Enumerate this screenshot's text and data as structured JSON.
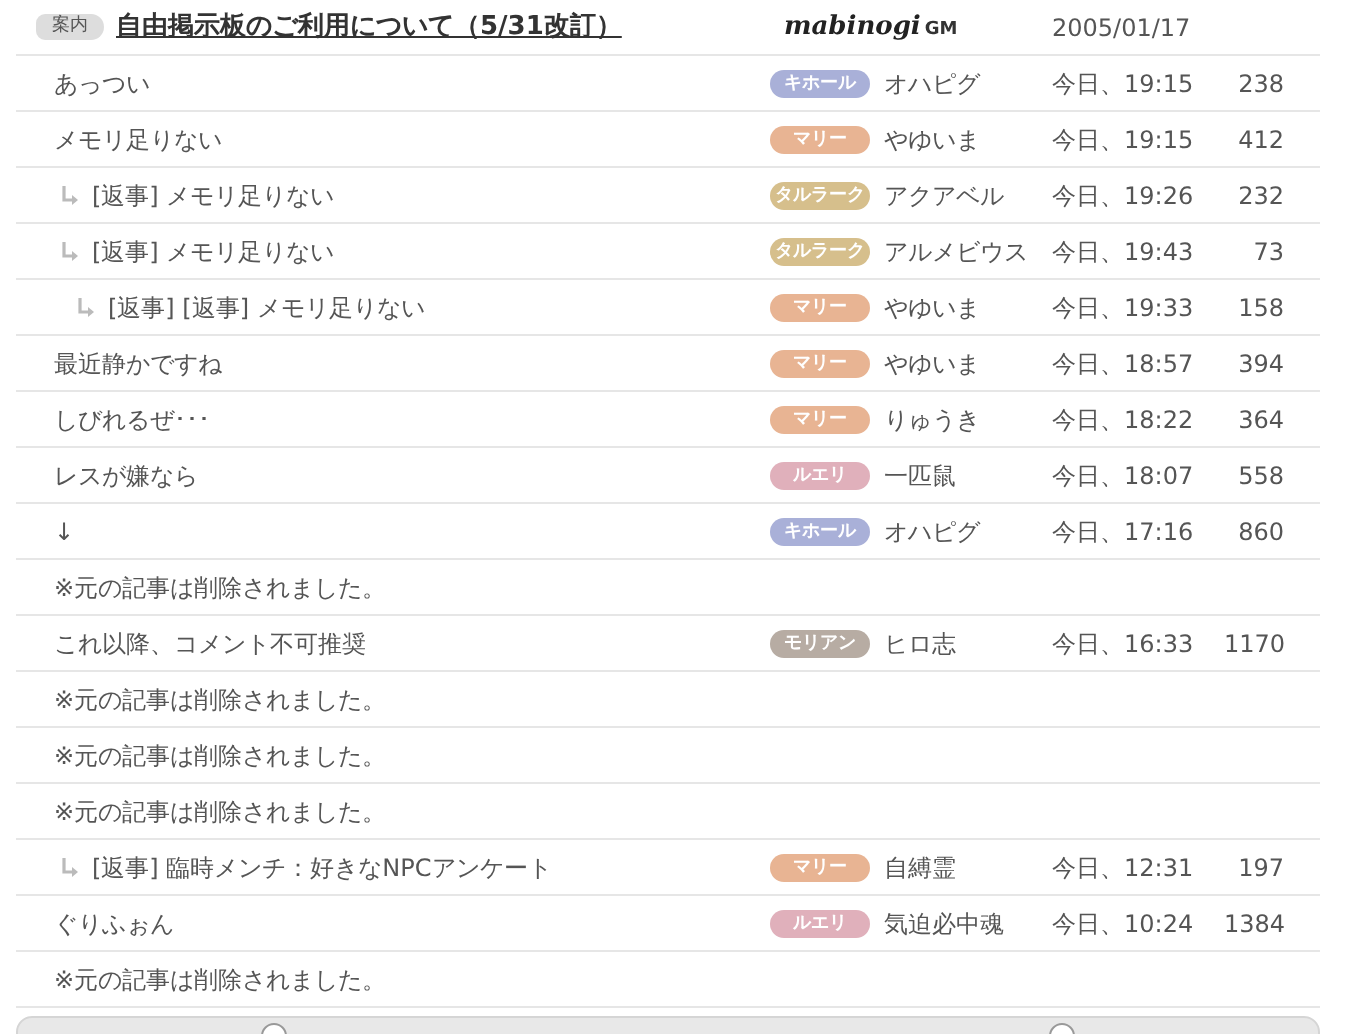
{
  "notice": {
    "tag": "案内",
    "title": "自由掲示板のご利用について（5/31改訂）",
    "logo_text": "mabinogi",
    "logo_suffix": "GM",
    "date": "2005/01/17"
  },
  "posts": [
    {
      "kind": "post",
      "title": "あっつい",
      "server": "キホール",
      "color": "#a9b0d8",
      "author": "オハピグ",
      "time": "今日、19:15",
      "views": "238"
    },
    {
      "kind": "post",
      "title": "メモリ足りない",
      "server": "マリー",
      "color": "#e8b493",
      "author": "やゆいま",
      "time": "今日、19:15",
      "views": "412",
      "children": [
        {
          "kind": "post",
          "title": "[返事] メモリ足りない",
          "server": "タルラーク",
          "color": "#d6bf8c",
          "author": "アクアベル",
          "time": "今日、19:26",
          "views": "232"
        },
        {
          "kind": "post",
          "title": "[返事] メモリ足りない",
          "server": "タルラーク",
          "color": "#d6bf8c",
          "author": "アルメビウス",
          "time": "今日、19:43",
          "views": "73",
          "children": [
            {
              "kind": "post",
              "title": "[返事] [返事] メモリ足りない",
              "server": "マリー",
              "color": "#e8b493",
              "author": "やゆいま",
              "time": "今日、19:33",
              "views": "158"
            }
          ]
        }
      ]
    },
    {
      "kind": "post",
      "title": "最近静かですね",
      "server": "マリー",
      "color": "#e8b493",
      "author": "やゆいま",
      "time": "今日、18:57",
      "views": "394"
    },
    {
      "kind": "post",
      "title": "しびれるぜ･･･",
      "server": "マリー",
      "color": "#e8b493",
      "author": "りゅうき",
      "time": "今日、18:22",
      "views": "364"
    },
    {
      "kind": "post",
      "title": "レスが嫌なら",
      "server": "ルエリ",
      "color": "#e0b0bb",
      "author": "一匹鼠",
      "time": "今日、18:07",
      "views": "558"
    },
    {
      "kind": "post",
      "title": "↓",
      "server": "キホール",
      "color": "#a9b0d8",
      "author": "オハピグ",
      "time": "今日、17:16",
      "views": "860"
    },
    {
      "kind": "deleted",
      "text": "※元の記事は削除されました。"
    },
    {
      "kind": "post",
      "title": "これ以降、コメント不可推奨",
      "server": "モリアン",
      "color": "#b7aca3",
      "author": "ヒロ志",
      "time": "今日、16:33",
      "views": "1170"
    },
    {
      "kind": "deleted",
      "text": "※元の記事は削除されました。"
    },
    {
      "kind": "deleted",
      "text": "※元の記事は削除されました。"
    },
    {
      "kind": "deleted",
      "text": "※元の記事は削除されました。",
      "children": [
        {
          "kind": "post",
          "title": "[返事] 臨時メンチ：好きなNPCアンケート",
          "server": "マリー",
          "color": "#e8b493",
          "author": "自縛霊",
          "time": "今日、12:31",
          "views": "197"
        }
      ]
    },
    {
      "kind": "post",
      "title": "ぐりふぉん",
      "server": "ルエリ",
      "color": "#e0b0bb",
      "author": "気迫必中魂",
      "time": "今日、10:24",
      "views": "1384"
    },
    {
      "kind": "deleted",
      "text": "※元の記事は削除されました。"
    }
  ]
}
